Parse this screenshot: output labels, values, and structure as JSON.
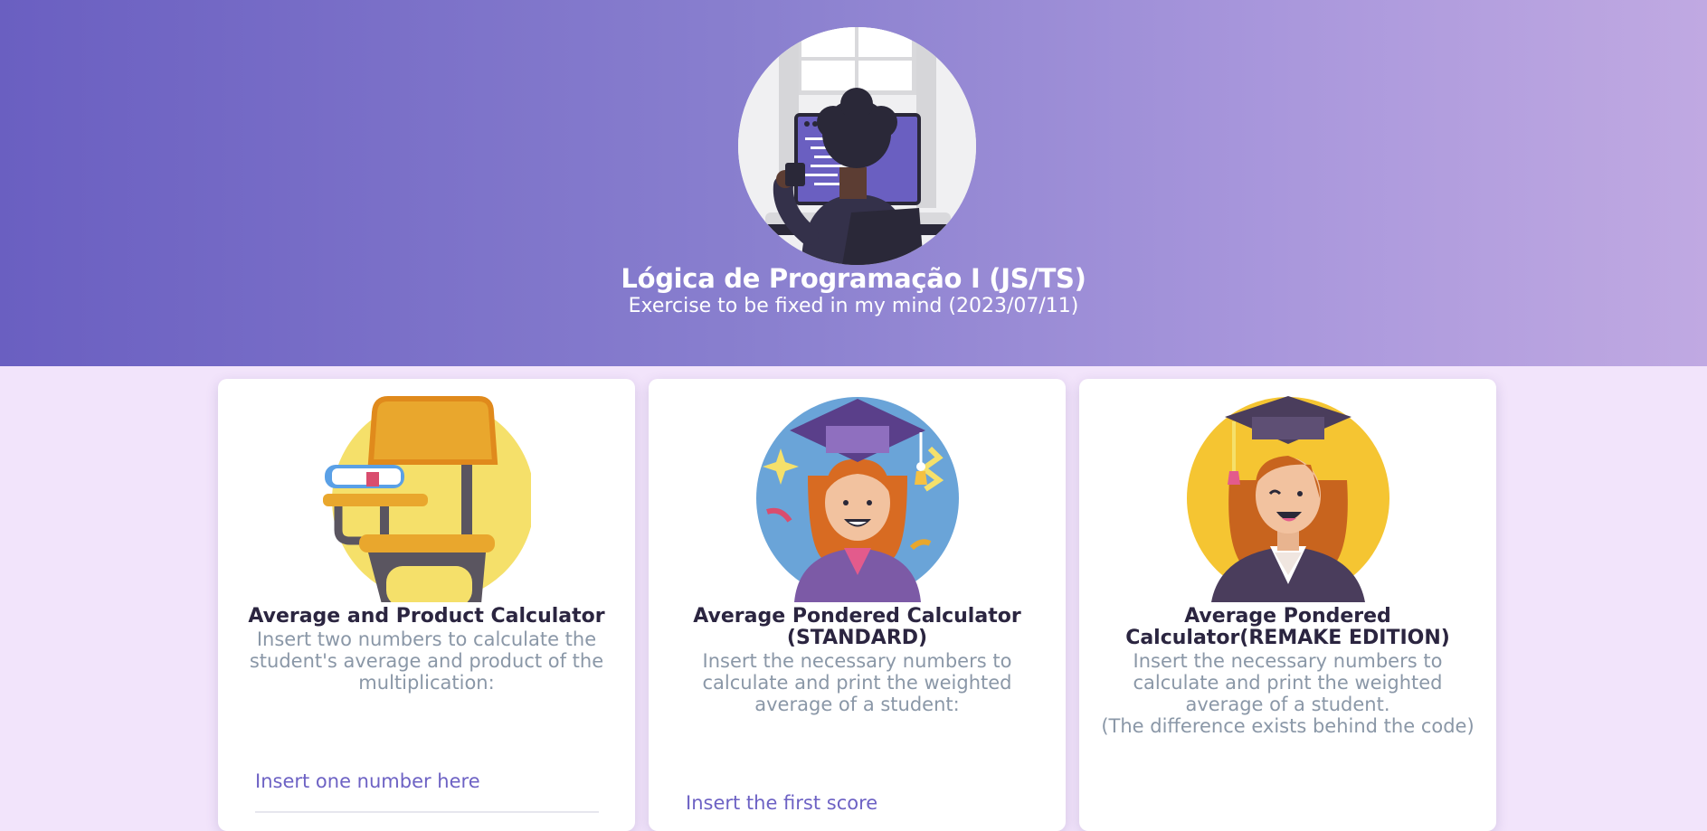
{
  "header": {
    "title": "Lógica de Programação I (JS/TS)",
    "subtitle": "Exercise to be fixed in my mind (2023/07/11)",
    "avatar_icon": "person-coding-at-computer-illustration"
  },
  "cards": [
    {
      "title": "Average and Product Calculator",
      "description": "Insert two numbers to calculate the student's average and product of the multiplication:",
      "illustration": "school-desk-with-books-illustration",
      "input_placeholder": "Insert one number here"
    },
    {
      "title": "Average Pondered Calculator (STANDARD)",
      "description": "Insert the necessary numbers to calculate and print the weighted average of a student:",
      "illustration": "graduate-student-illustration",
      "input_placeholder": "Insert the first score"
    },
    {
      "title": "Average Pondered Calculator(REMAKE EDITION)",
      "description": "Insert the necessary numbers to calculate and print the weighted average of a student.",
      "note": "(The difference exists behind the code)",
      "illustration": "graduate-woman-illustration"
    }
  ],
  "colors": {
    "header_gradient_start": "#6a5fc1",
    "header_gradient_end": "#c0a9e2",
    "page_background": "#f2e4fb",
    "accent": "#6d62c4",
    "muted_text": "#8a97a7"
  }
}
